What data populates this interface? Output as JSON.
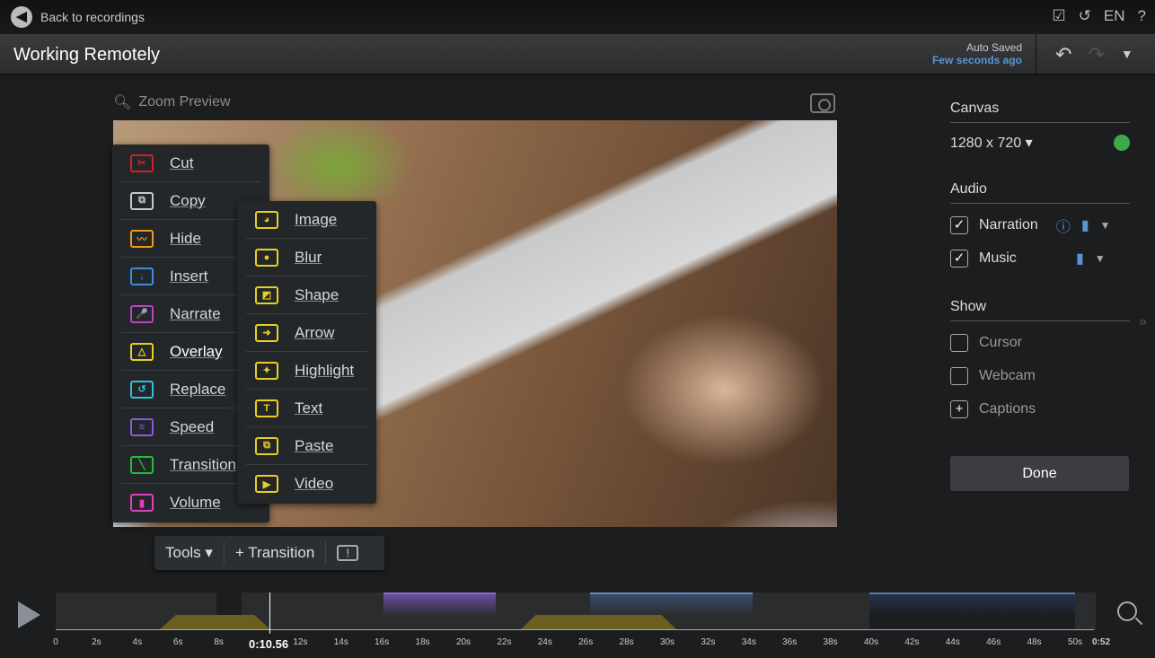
{
  "topbar": {
    "back_label": "Back to recordings",
    "lang": "EN",
    "help": "?"
  },
  "header": {
    "title": "Working Remotely",
    "auto_saved": "Auto Saved",
    "saved_time": "Few seconds ago"
  },
  "preview": {
    "zoom_label": "Zoom Preview"
  },
  "tools_menu": [
    {
      "label": "Cut",
      "icon": "scissors-icon",
      "color": "#d42020",
      "g": "✂"
    },
    {
      "label": "Copy",
      "icon": "copy-icon",
      "color": "#c8c8c8",
      "g": "⧉"
    },
    {
      "label": "Hide",
      "icon": "eye-closed-icon",
      "color": "#f09a18",
      "g": "〰"
    },
    {
      "label": "Insert",
      "icon": "insert-icon",
      "color": "#3a8de0",
      "g": "↓"
    },
    {
      "label": "Narrate",
      "icon": "microphone-icon",
      "color": "#c040c8",
      "g": "🎤"
    },
    {
      "label": "Overlay",
      "icon": "overlay-icon",
      "color": "#e8d020",
      "g": "△"
    },
    {
      "label": "Replace",
      "icon": "replace-icon",
      "color": "#30c0d8",
      "g": "↺"
    },
    {
      "label": "Speed",
      "icon": "speed-icon",
      "color": "#8a5ae0",
      "g": "≡"
    },
    {
      "label": "Transition",
      "icon": "transition-icon",
      "color": "#20c030",
      "g": "╲"
    },
    {
      "label": "Volume",
      "icon": "volume-icon",
      "color": "#e040c0",
      "g": "▮"
    }
  ],
  "overlay_menu": [
    {
      "label": "Image",
      "icon": "image-icon",
      "g": "◕"
    },
    {
      "label": "Blur",
      "icon": "blur-icon",
      "g": "●"
    },
    {
      "label": "Shape",
      "icon": "shape-icon",
      "g": "◩"
    },
    {
      "label": "Arrow",
      "icon": "arrow-icon",
      "g": "➜"
    },
    {
      "label": "Highlight",
      "icon": "highlight-icon",
      "g": "✦"
    },
    {
      "label": "Text",
      "icon": "text-icon",
      "g": "T"
    },
    {
      "label": "Paste",
      "icon": "paste-icon",
      "g": "⧉"
    },
    {
      "label": "Video",
      "icon": "video-icon",
      "g": "▶"
    }
  ],
  "overlay_color": "#e8d020",
  "toolbar": {
    "tools": "Tools ▾",
    "transition": "+ Transition",
    "warn": "!"
  },
  "panel": {
    "canvas_title": "Canvas",
    "canvas_size": "1280 x 720 ▾",
    "canvas_color": "#3caa4a",
    "audio_title": "Audio",
    "narration": "Narration",
    "music": "Music",
    "show_title": "Show",
    "cursor": "Cursor",
    "webcam": "Webcam",
    "captions": "Captions",
    "done": "Done"
  },
  "timeline": {
    "current_time": "0:10.56",
    "ticks": [
      "0",
      "2s",
      "4s",
      "6s",
      "8s",
      "",
      "12s",
      "14s",
      "16s",
      "18s",
      "20s",
      "22s",
      "24s",
      "26s",
      "28s",
      "30s",
      "32s",
      "34s",
      "36s",
      "38s",
      "40s",
      "42s",
      "44s",
      "46s",
      "48s",
      "50s"
    ],
    "end": "0:52"
  }
}
